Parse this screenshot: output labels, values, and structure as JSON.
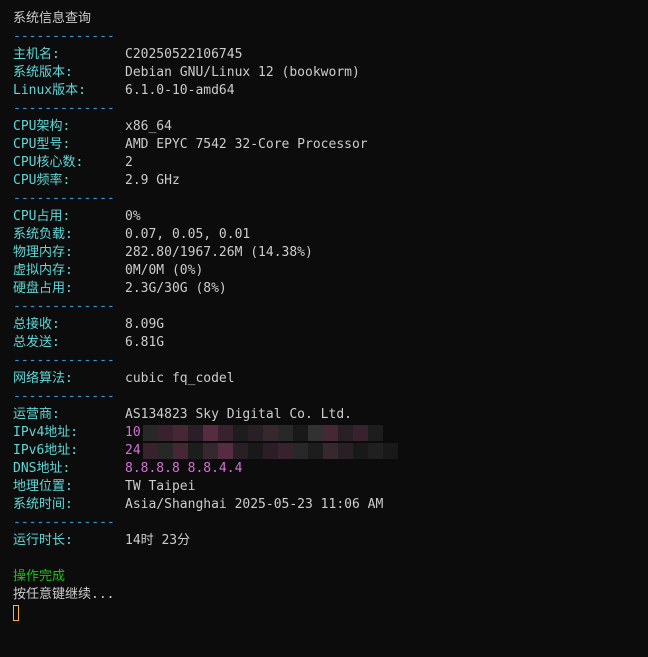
{
  "title": "系统信息查询",
  "separator": "-------------",
  "host": {
    "label": "主机名:",
    "value": "C20250522106745"
  },
  "os_version": {
    "label": "系统版本:",
    "value": "Debian GNU/Linux 12 (bookworm)"
  },
  "linux_version": {
    "label": "Linux版本:",
    "value": "6.1.0-10-amd64"
  },
  "cpu_arch": {
    "label": "CPU架构:",
    "value": "x86_64"
  },
  "cpu_model": {
    "label": "CPU型号:",
    "value": "AMD EPYC 7542 32-Core Processor"
  },
  "cpu_cores": {
    "label": "CPU核心数:",
    "value": "2"
  },
  "cpu_freq": {
    "label": "CPU频率:",
    "value": "2.9 GHz"
  },
  "cpu_usage": {
    "label": "CPU占用:",
    "value": "0%"
  },
  "load": {
    "label": "系统负载:",
    "value": "0.07, 0.05, 0.01"
  },
  "mem": {
    "label": "物理内存:",
    "value": "282.80/1967.26M (14.38%)"
  },
  "swap": {
    "label": "虚拟内存:",
    "value": "0M/0M (0%)"
  },
  "disk": {
    "label": "硬盘占用:",
    "value": "2.3G/30G (8%)"
  },
  "rx": {
    "label": "总接收:",
    "value": "8.09G"
  },
  "tx": {
    "label": "总发送:",
    "value": "6.81G"
  },
  "tcp_algo": {
    "label": "网络算法:",
    "value": "cubic fq_codel"
  },
  "isp": {
    "label": "运营商:",
    "value": "AS134823 Sky Digital Co. Ltd."
  },
  "ipv4": {
    "label": "IPv4地址:",
    "value": "10"
  },
  "ipv6": {
    "label": "IPv6地址:",
    "value": "24"
  },
  "dns": {
    "label": "DNS地址:",
    "value": "8.8.8.8 8.8.4.4"
  },
  "location": {
    "label": "地理位置:",
    "value": "TW Taipei"
  },
  "sys_time": {
    "label": "系统时间:",
    "value": "Asia/Shanghai 2025-05-23 11:06 AM"
  },
  "uptime": {
    "label": "运行时长:",
    "value": "14时 23分"
  },
  "done_text": "操作完成",
  "continue_prompt": "按任意键继续...",
  "colors": {
    "background": "#0c0c0c",
    "text": "#cccccc",
    "label": "#61d6d6",
    "separator": "#3a96dd",
    "ip_value": "#d670d6",
    "success": "#16c60c",
    "cursor": "#f9b53f"
  }
}
